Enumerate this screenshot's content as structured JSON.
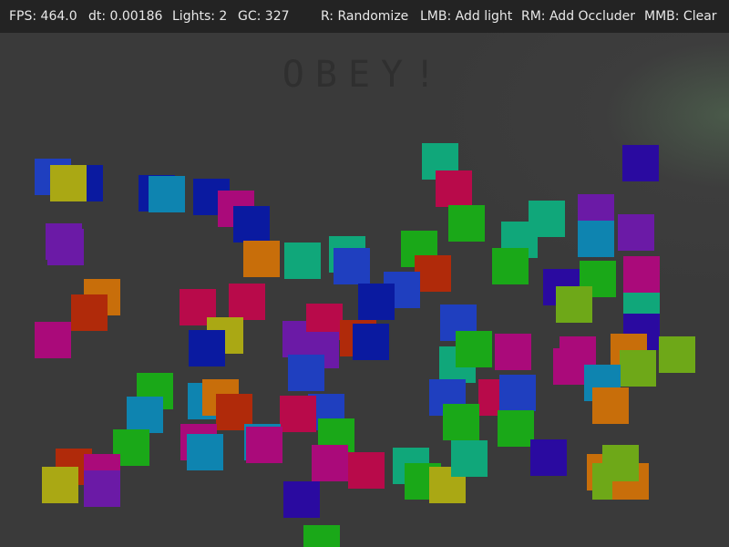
{
  "hud": {
    "fps": "FPS: 464.0",
    "dt": "dt: 0.00186",
    "lights": "Lights: 2",
    "gc": "GC: 327",
    "randomize": "R: Randomize",
    "add_light": "LMB: Add light",
    "add_occluder": "RM: Add Occluder",
    "clear": "MMB:  Clear"
  },
  "scene": {
    "title": "OBEY!",
    "background_color": "#3a3a3a",
    "hud_color": "#232323",
    "occluder_colors": [
      "#1f3fbf",
      "#0a1aa0",
      "#aaa814",
      "#6b1aa6",
      "#10a77a",
      "#b0082a",
      "#1aa818",
      "#aa0a7a",
      "#c86e0a",
      "#0e84b0",
      "#b80a4a",
      "#b02a0a",
      "#6ea818",
      "#2a0aa0"
    ]
  }
}
